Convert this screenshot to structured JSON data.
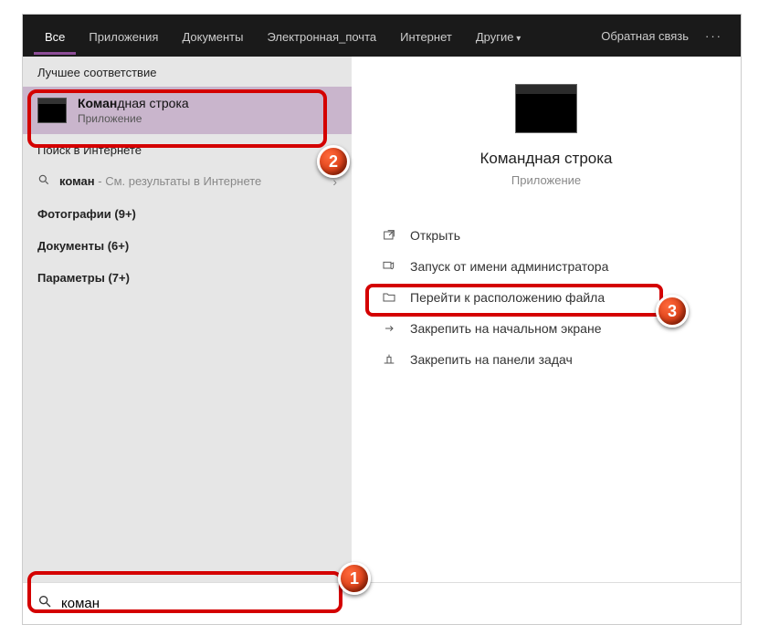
{
  "tabs": {
    "all": "Все",
    "apps": "Приложения",
    "docs": "Документы",
    "email": "Электронная_почта",
    "internet": "Интернет",
    "other": "Другие"
  },
  "feedback": "Обратная связь",
  "left": {
    "bestHeader": "Лучшее соответствие",
    "bestMatch": {
      "prefix": "Коман",
      "suffix": "дная строка",
      "sub": "Приложение"
    },
    "webHeader": "Поиск в Интернете",
    "webQuery": "коман",
    "webHint": " - См. результаты в Интернете",
    "photos": "Фотографии (9+)",
    "documents": "Документы (6+)",
    "params": "Параметры (7+)"
  },
  "right": {
    "title": "Командная строка",
    "sub": "Приложение",
    "actions": {
      "open": "Открыть",
      "runAdmin": "Запуск от имени администратора",
      "goto": "Перейти к расположению файла",
      "pinStart": "Закрепить на начальном экране",
      "pinTaskbar": "Закрепить на панели задач"
    }
  },
  "search": {
    "value": "коман"
  },
  "markers": {
    "m1": "1",
    "m2": "2",
    "m3": "3"
  }
}
